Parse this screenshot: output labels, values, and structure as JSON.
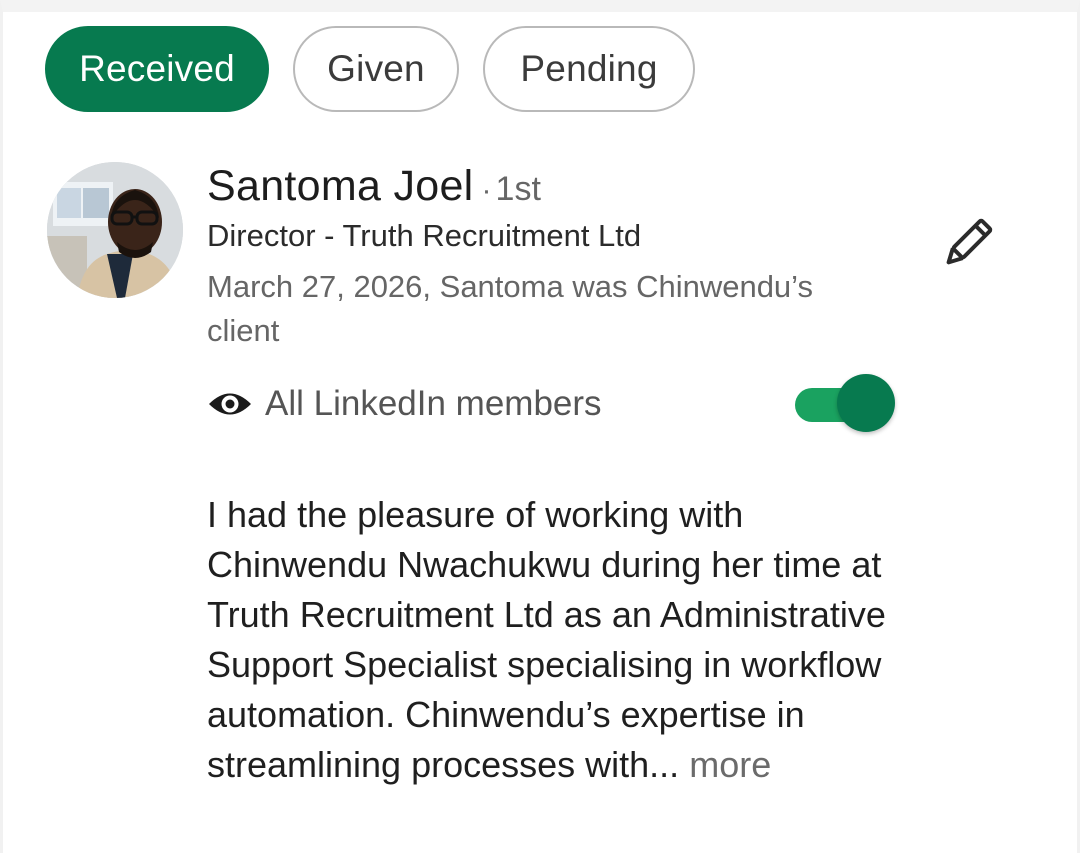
{
  "tabs": [
    {
      "label": "Received",
      "active": true
    },
    {
      "label": "Given",
      "active": false
    },
    {
      "label": "Pending",
      "active": false
    }
  ],
  "recommendation": {
    "name": "Santoma Joel",
    "separator": "·",
    "degree": "1st",
    "headline": "Director - Truth Recruitment Ltd",
    "meta": "March 27, 2026, Santoma was Chinwendu’s client",
    "visibility_label": "All LinkedIn members",
    "visibility_on": true,
    "body": "I had the pleasure of working with Chinwendu Nwachukwu during her time at Truth Recruitment Ltd as an Administrative Support Specialist specialising in workflow automation. Chinwendu’s expertise in streamlining processes with...",
    "more_label": "more"
  },
  "icons": {
    "edit": "pencil-icon",
    "visibility": "eye-icon"
  },
  "colors": {
    "accent": "#077a4f",
    "toggle_track": "#1aa260"
  }
}
